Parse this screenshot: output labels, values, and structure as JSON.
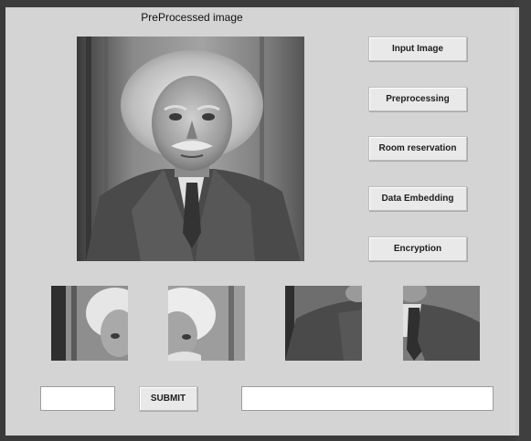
{
  "window": {
    "image_title": "PreProcessed image"
  },
  "buttons": {
    "input_image": "Input Image",
    "preprocessing": "Preprocessing",
    "room_reservation": "Room reservation",
    "data_embedding": "Data Embedding",
    "encryption": "Encryption",
    "submit": "SUBMIT"
  },
  "inputs": {
    "left_value": "",
    "right_value": ""
  },
  "colors": {
    "panel": "#d4d4d4",
    "frame": "#3a3a3a",
    "button": "#e9e9e9"
  }
}
